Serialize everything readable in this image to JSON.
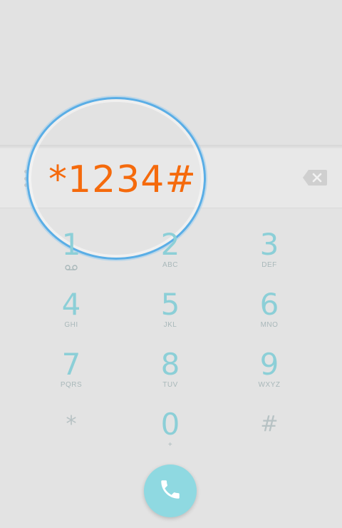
{
  "dialer": {
    "digits": "*1234#"
  },
  "keypad": {
    "keys": [
      {
        "digit": "1",
        "letters": "",
        "icon": "voicemail-icon"
      },
      {
        "digit": "2",
        "letters": "ABC"
      },
      {
        "digit": "3",
        "letters": "DEF"
      },
      {
        "digit": "4",
        "letters": "GHI"
      },
      {
        "digit": "5",
        "letters": "JKL"
      },
      {
        "digit": "6",
        "letters": "MNO"
      },
      {
        "digit": "7",
        "letters": "PQRS"
      },
      {
        "digit": "8",
        "letters": "TUV"
      },
      {
        "digit": "9",
        "letters": "WXYZ"
      },
      {
        "digit": "*",
        "letters": ""
      },
      {
        "digit": "0",
        "letters": "+"
      },
      {
        "digit": "#",
        "letters": ""
      }
    ]
  },
  "icons": {
    "menu": "overflow-menu-icon",
    "backspace": "backspace-icon",
    "call": "phone-icon"
  },
  "colors": {
    "digits_text": "#f56a0c",
    "key_digit": "#8ccfd7",
    "call_button": "#8fd9e1",
    "highlight_ring": "#5aaee6"
  }
}
